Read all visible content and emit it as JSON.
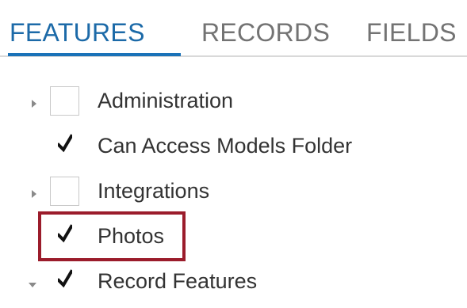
{
  "tabs": [
    {
      "label": "FEATURES",
      "active": true
    },
    {
      "label": "RECORDS",
      "active": false
    },
    {
      "label": "FIELDS",
      "active": false
    }
  ],
  "tree": {
    "items": [
      {
        "label": "Administration",
        "checked": false,
        "expander": "collapsed"
      },
      {
        "label": "Can Access Models Folder",
        "checked": true,
        "expander": "none"
      },
      {
        "label": "Integrations",
        "checked": false,
        "expander": "collapsed"
      },
      {
        "label": "Photos",
        "checked": true,
        "expander": "none",
        "highlighted": true
      },
      {
        "label": "Record Features",
        "checked": true,
        "expander": "expanded"
      }
    ]
  },
  "colors": {
    "active_tab": "#1c6aa8",
    "inactive_tab": "#737373",
    "highlight": "#9b1c2b"
  },
  "icons": {
    "expander_collapsed": "caret-right-icon",
    "expander_expanded": "caret-down-icon",
    "check": "checkmark-icon"
  }
}
